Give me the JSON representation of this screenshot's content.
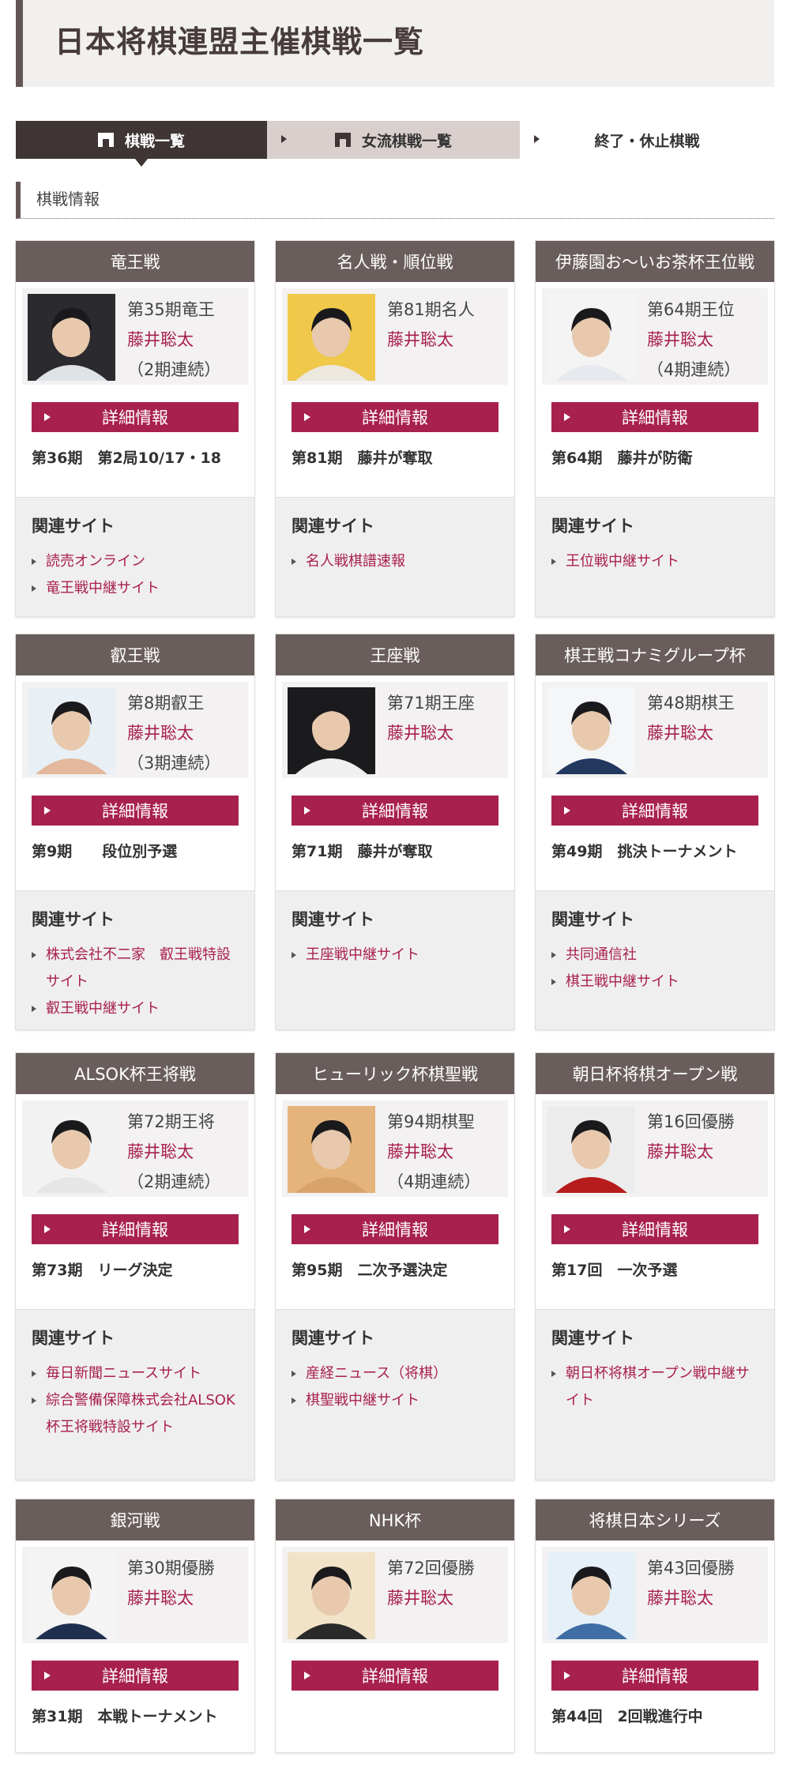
{
  "page": {
    "title": "日本将棋連盟主催棋戦一覧",
    "tabs": [
      "棋戦一覧",
      "女流棋戦一覧",
      "終了・休止棋戦"
    ],
    "section_title": "棋戦情報",
    "detail_label": "詳細情報",
    "related_label": "関連サイト"
  },
  "colors": {
    "accent": "#a8204e",
    "header_brown": "#6a5e5d",
    "dark": "#3e3534"
  },
  "cards": [
    {
      "title": "竜王戦",
      "lines": [
        "第35期竜王",
        "藤井聡太",
        "（2期連続）"
      ],
      "status": "第36期　第2局10/17・18",
      "links": [
        "読売オンライン",
        "竜王戦中継サイト"
      ]
    },
    {
      "title": "名人戦・順位戦",
      "lines": [
        "第81期名人",
        "藤井聡太",
        ""
      ],
      "status": "第81期　藤井が奪取",
      "links": [
        "名人戦棋譜速報"
      ]
    },
    {
      "title": "伊藤園お～いお茶杯王位戦",
      "lines": [
        "第64期王位",
        "藤井聡太",
        "（4期連続）"
      ],
      "status": "第64期　藤井が防衛",
      "links": [
        "王位戦中継サイト"
      ]
    },
    {
      "title": "叡王戦",
      "lines": [
        "第8期叡王",
        "藤井聡太",
        "（3期連続）"
      ],
      "status": "第9期　　段位別予選",
      "links": [
        "株式会社不二家　叡王戦特設サイト",
        "叡王戦中継サイト"
      ]
    },
    {
      "title": "王座戦",
      "lines": [
        "第71期王座",
        "藤井聡太",
        ""
      ],
      "status": "第71期　藤井が奪取",
      "links": [
        "王座戦中継サイト"
      ]
    },
    {
      "title": "棋王戦コナミグループ杯",
      "lines": [
        "第48期棋王",
        "藤井聡太",
        ""
      ],
      "status": "第49期　挑決トーナメント",
      "links": [
        "共同通信社",
        "棋王戦中継サイト"
      ]
    },
    {
      "title": "ALSOK杯王将戦",
      "lines": [
        "第72期王将",
        "藤井聡太",
        "（2期連続）"
      ],
      "status": "第73期　リーグ決定",
      "links": [
        "毎日新聞ニュースサイト",
        "綜合警備保障株式会社ALSOK杯王将戦特設サイト"
      ]
    },
    {
      "title": "ヒューリック杯棋聖戦",
      "lines": [
        "第94期棋聖",
        "藤井聡太",
        "（4期連続）"
      ],
      "status": "第95期　二次予選決定",
      "links": [
        "産経ニュース（将棋）",
        "棋聖戦中継サイト"
      ]
    },
    {
      "title": "朝日杯将棋オープン戦",
      "lines": [
        "第16回優勝",
        "藤井聡太",
        ""
      ],
      "status": "第17回　一次予選",
      "links": [
        "朝日杯将棋オープン戦中継サイト"
      ]
    },
    {
      "title": "銀河戦",
      "lines": [
        "第30期優勝",
        "藤井聡太",
        ""
      ],
      "status": "第31期　本戦トーナメント",
      "links": []
    },
    {
      "title": "NHK杯",
      "lines": [
        "第72回優勝",
        "藤井聡太",
        ""
      ],
      "status": "",
      "links": []
    },
    {
      "title": "将棋日本シリーズ",
      "lines": [
        "第43回優勝",
        "藤井聡太",
        ""
      ],
      "status": "第44回　2回戦進行中",
      "links": []
    }
  ]
}
